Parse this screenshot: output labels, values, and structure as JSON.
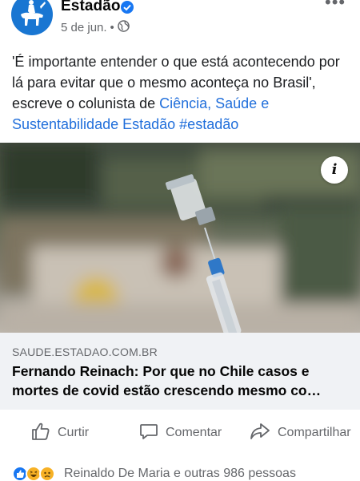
{
  "post": {
    "page_name": "Estadão",
    "date": "5 de jun.",
    "separator": "•",
    "more_menu": "•••",
    "text_plain": "'É importante entender o que está acontecendo por lá para evitar que o mesmo aconteça no Brasil', escreve o colunista de ",
    "text_link": "Ciência, Saúde e Sustentabilidade Estadão",
    "hashtag": "#estadão"
  },
  "link_card": {
    "domain": "SAUDE.ESTADAO.COM.BR",
    "title": "Fernando Reinach: Por que no Chile casos e mortes de covid estão crescendo mesmo co…",
    "info_label": "i"
  },
  "actions": {
    "like_label": "Curtir",
    "comment_label": "Comentar",
    "share_label": "Compartilhar"
  },
  "reactions": {
    "summary": "Reinaldo De Maria e outras 986 pessoas"
  },
  "colors": {
    "brand_blue": "#1877f2",
    "link_blue": "#216fdb",
    "secondary_text": "#65676b",
    "card_bg": "#f0f2f5"
  },
  "icons": [
    "verified-badge-icon",
    "globe-icon",
    "more-icon",
    "info-icon",
    "like-thumb-icon",
    "comment-icon",
    "share-icon",
    "like-reaction-icon",
    "haha-reaction-icon",
    "sad-reaction-icon"
  ]
}
